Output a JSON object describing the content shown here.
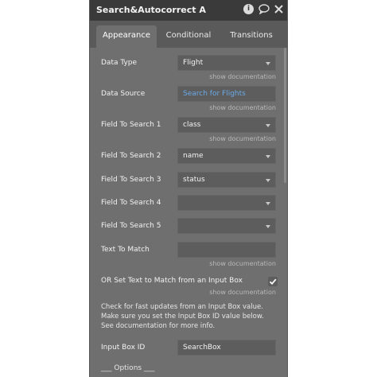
{
  "panel": {
    "title": "Search&Autocorrect A",
    "icons": [
      "info-icon",
      "comment-icon",
      "close-icon"
    ]
  },
  "tabs": [
    {
      "label": "Appearance",
      "active": true
    },
    {
      "label": "Conditional",
      "active": false
    },
    {
      "label": "Transitions",
      "active": false
    }
  ],
  "fields": {
    "data_type": {
      "label": "Data Type",
      "value": "Flight"
    },
    "data_source": {
      "label": "Data Source",
      "value": "Search for Flights"
    },
    "field_to_search_1": {
      "label": "Field To Search 1",
      "value": "class"
    },
    "field_to_search_2": {
      "label": "Field To Search 2",
      "value": "name"
    },
    "field_to_search_3": {
      "label": "Field To Search 3",
      "value": "status"
    },
    "field_to_search_4": {
      "label": "Field To Search 4",
      "value": ""
    },
    "field_to_search_5": {
      "label": "Field To Search 5",
      "value": ""
    },
    "text_to_match": {
      "label": "Text To Match",
      "value": ""
    },
    "input_box_id": {
      "label": "Input Box ID",
      "value": "SearchBox"
    }
  },
  "show_documentation": "show documentation",
  "input_box_toggle": {
    "label": "OR Set Text to Match from an Input Box",
    "checked": true
  },
  "info_text": "Check for fast updates from an Input Box value. Make sure you set the Input Box ID value below. See documentation for more info.",
  "options_heading": "___ Options ___",
  "colors": {
    "panel_bg": "#6f6f6f",
    "titlebar_bg": "#3a3a3a",
    "field_bg": "#5d5d5d",
    "link": "#6aa9e6"
  }
}
